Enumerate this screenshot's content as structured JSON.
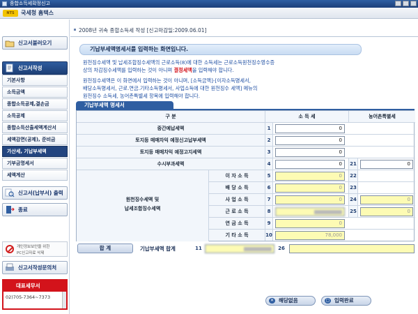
{
  "window": {
    "title": "종합소득세확정신고"
  },
  "brand": {
    "logo_text": "NTS",
    "name": "국세청 홈택스"
  },
  "sidebar": {
    "menu_load": "신고서불러오기",
    "menu_write": "신고서작성",
    "sub_items": [
      "기본사항",
      "소득금액",
      "종합소득공제,결손금",
      "소득공제",
      "종합소득산출세액계산서",
      "세액감면(공제), 준비금",
      "가산세, 기납부세액",
      "기부금명세서",
      "세액계산"
    ],
    "menu_output": "신고서(납부서) 출력",
    "menu_exit": "종료",
    "notice_line1": "개인정보보안을 위한",
    "notice_line2": "PC신고자료 삭제",
    "menu_help": "신고서작성문의처",
    "office_title": "대표세무서",
    "office_phone": "02)705-7364~7373"
  },
  "header": {
    "report_title": "2008년 귀속 종합소득세 작성 [신고마감일:2009.06.01]"
  },
  "banner": {
    "text": "기납부세액명세서를 입력하는 화면입니다."
  },
  "messages": {
    "line1": "원천징수세액 및 납세조합징수세액의 근로소득(8)에 대한 소득세는 근로소득원천징수영수증",
    "line2_a": "상의 차감징수세액를 입력하는 것이 아니며 ",
    "line2_red": "결정세액",
    "line2_b": "을 입력해야 합니다.",
    "line3": "원천징수세액은 이 화면에서 입력하는 것이 아니며, [소득금액]-[이자소득명세서,",
    "line4": "배당소득명세서, 근로.연금.기타소득명세서, 사업소득에 대한 원천징수 세액] 메뉴의",
    "line5": "원천징수 소득세, 농어촌특별세 항목에 입력해야 합니다."
  },
  "section": {
    "title": "기납부세액 명세서"
  },
  "table": {
    "head_category": "구          분",
    "head_income_tax": "소 득 세",
    "head_rural_tax": "농어촌특별세",
    "rows": [
      {
        "label": "중간예납세액",
        "no": "1",
        "income_tax": "0"
      },
      {
        "label": "토지등 매매차익 예정신고납부세액",
        "no": "2",
        "income_tax": "0"
      },
      {
        "label": "토지등 매매차익 예정고지세액",
        "no": "3",
        "income_tax": "0"
      },
      {
        "label": "수시부과세액",
        "no": "4",
        "income_tax": "0",
        "rural_no": "21",
        "rural_tax": "0"
      }
    ],
    "withholding_group_line1": "원천징수세액 및",
    "withholding_group_line2": "납세조합징수세액",
    "withholding_rows": [
      {
        "label": "이 자 소 득",
        "no": "5",
        "income_tax": "0",
        "rural_no": "22"
      },
      {
        "label": "배 당 소 득",
        "no": "6",
        "income_tax": "0",
        "rural_no": "23"
      },
      {
        "label": "사 업 소 득",
        "no": "7",
        "income_tax": "0",
        "rural_no": "24",
        "rural_tax": "0"
      },
      {
        "label": "근 로 소 득",
        "no": "8",
        "income_tax": "",
        "rural_no": "25",
        "rural_tax": "0"
      },
      {
        "label": "연 금 소 득",
        "no": "9",
        "income_tax": "0"
      },
      {
        "label": "기 타 소 득",
        "no": "10",
        "income_tax": "78,000"
      }
    ],
    "total_button": "합    계",
    "total_label": "기납부세액 합계",
    "total_no": "11",
    "total_rural_no": "26"
  },
  "footer": {
    "btn_none": "해당없음",
    "btn_done": "입력완료"
  },
  "colors": {
    "accent": "#2f5ea1",
    "alert_red": "#d3131b",
    "input_yellow": "#fdfbb4"
  }
}
